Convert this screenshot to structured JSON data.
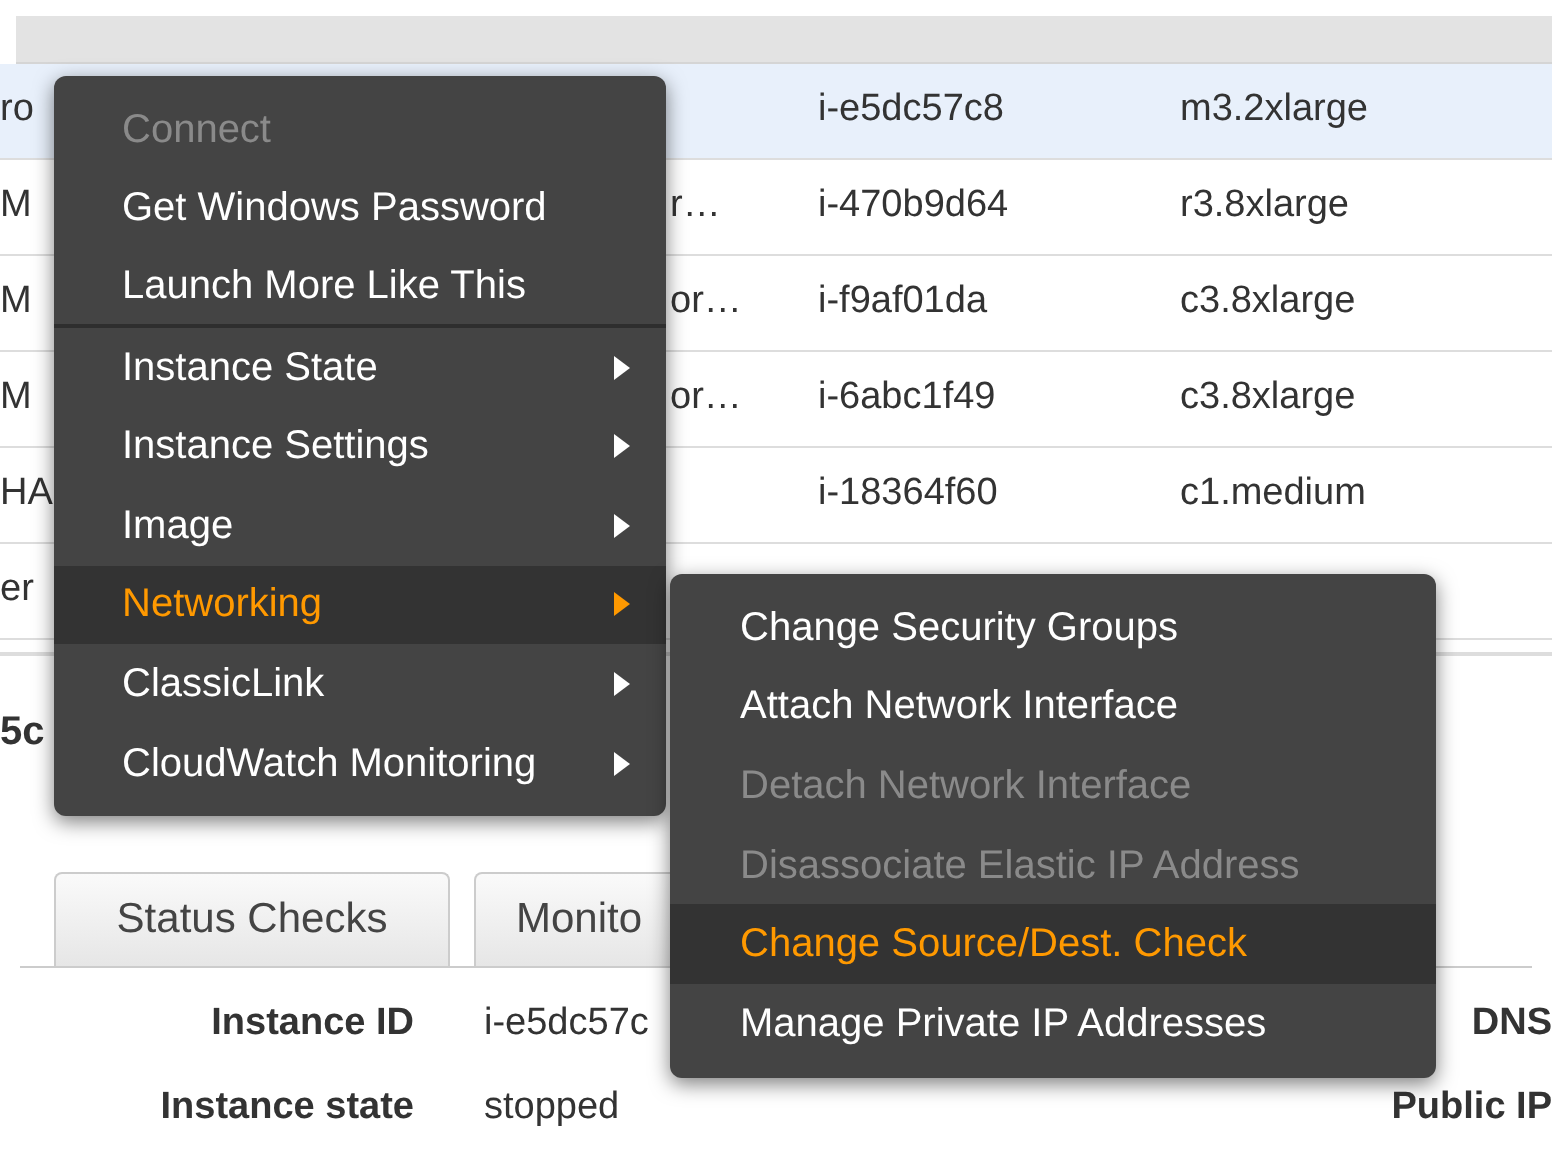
{
  "table": {
    "rows": [
      {
        "column_1": "ro",
        "instance_id": "i-e5dc57c8",
        "instance_type": "m3.2xlarge",
        "selected": true
      },
      {
        "column_1": "M",
        "column_2": "r…",
        "instance_id": "i-470b9d64",
        "instance_type": "r3.8xlarge",
        "selected": false
      },
      {
        "column_1": "M",
        "column_2": "or…",
        "instance_id": "i-f9af01da",
        "instance_type": "c3.8xlarge",
        "selected": false
      },
      {
        "column_1": "M",
        "column_2": "or…",
        "instance_id": "i-6abc1f49",
        "instance_type": "c3.8xlarge",
        "selected": false
      },
      {
        "column_1": "HA",
        "instance_id": "i-18364f60",
        "instance_type": "c1.medium",
        "selected": false
      },
      {
        "column_1": "er",
        "selected": false
      }
    ]
  },
  "details_heading": "5c",
  "tabs": [
    {
      "label": "Status Checks",
      "selected": false
    },
    {
      "label": "Monito",
      "selected": false
    }
  ],
  "details": [
    {
      "label": "Instance ID",
      "value": "i-e5dc57c",
      "right_label": "DNS"
    },
    {
      "label": "Instance state",
      "value": "stopped",
      "right_label": "Public IP"
    }
  ],
  "context_menu": {
    "items": [
      {
        "label": "Connect",
        "disabled": true,
        "selected": false,
        "submenu": false,
        "separator_after": false
      },
      {
        "label": "Get Windows Password",
        "disabled": false,
        "selected": false,
        "submenu": false,
        "separator_after": false
      },
      {
        "label": "Launch More Like This",
        "disabled": false,
        "selected": false,
        "submenu": false,
        "separator_after": true
      },
      {
        "label": "Instance State",
        "disabled": false,
        "selected": false,
        "submenu": true,
        "separator_after": false
      },
      {
        "label": "Instance Settings",
        "disabled": false,
        "selected": false,
        "submenu": true,
        "separator_after": false
      },
      {
        "label": "Image",
        "disabled": false,
        "selected": false,
        "submenu": true,
        "separator_after": false
      },
      {
        "label": "Networking",
        "disabled": false,
        "selected": true,
        "submenu": true,
        "separator_after": false
      },
      {
        "label": "ClassicLink",
        "disabled": false,
        "selected": false,
        "submenu": true,
        "separator_after": false
      },
      {
        "label": "CloudWatch Monitoring",
        "disabled": false,
        "selected": false,
        "submenu": true,
        "separator_after": false
      }
    ]
  },
  "submenu": {
    "items": [
      {
        "label": "Change Security Groups",
        "disabled": false,
        "selected": false
      },
      {
        "label": "Attach Network Interface",
        "disabled": false,
        "selected": false
      },
      {
        "label": "Detach Network Interface",
        "disabled": true,
        "selected": false
      },
      {
        "label": "Disassociate Elastic IP Address",
        "disabled": true,
        "selected": false
      },
      {
        "label": "Change Source/Dest. Check",
        "disabled": false,
        "selected": true
      },
      {
        "label": "Manage Private IP Addresses",
        "disabled": false,
        "selected": false
      }
    ]
  }
}
